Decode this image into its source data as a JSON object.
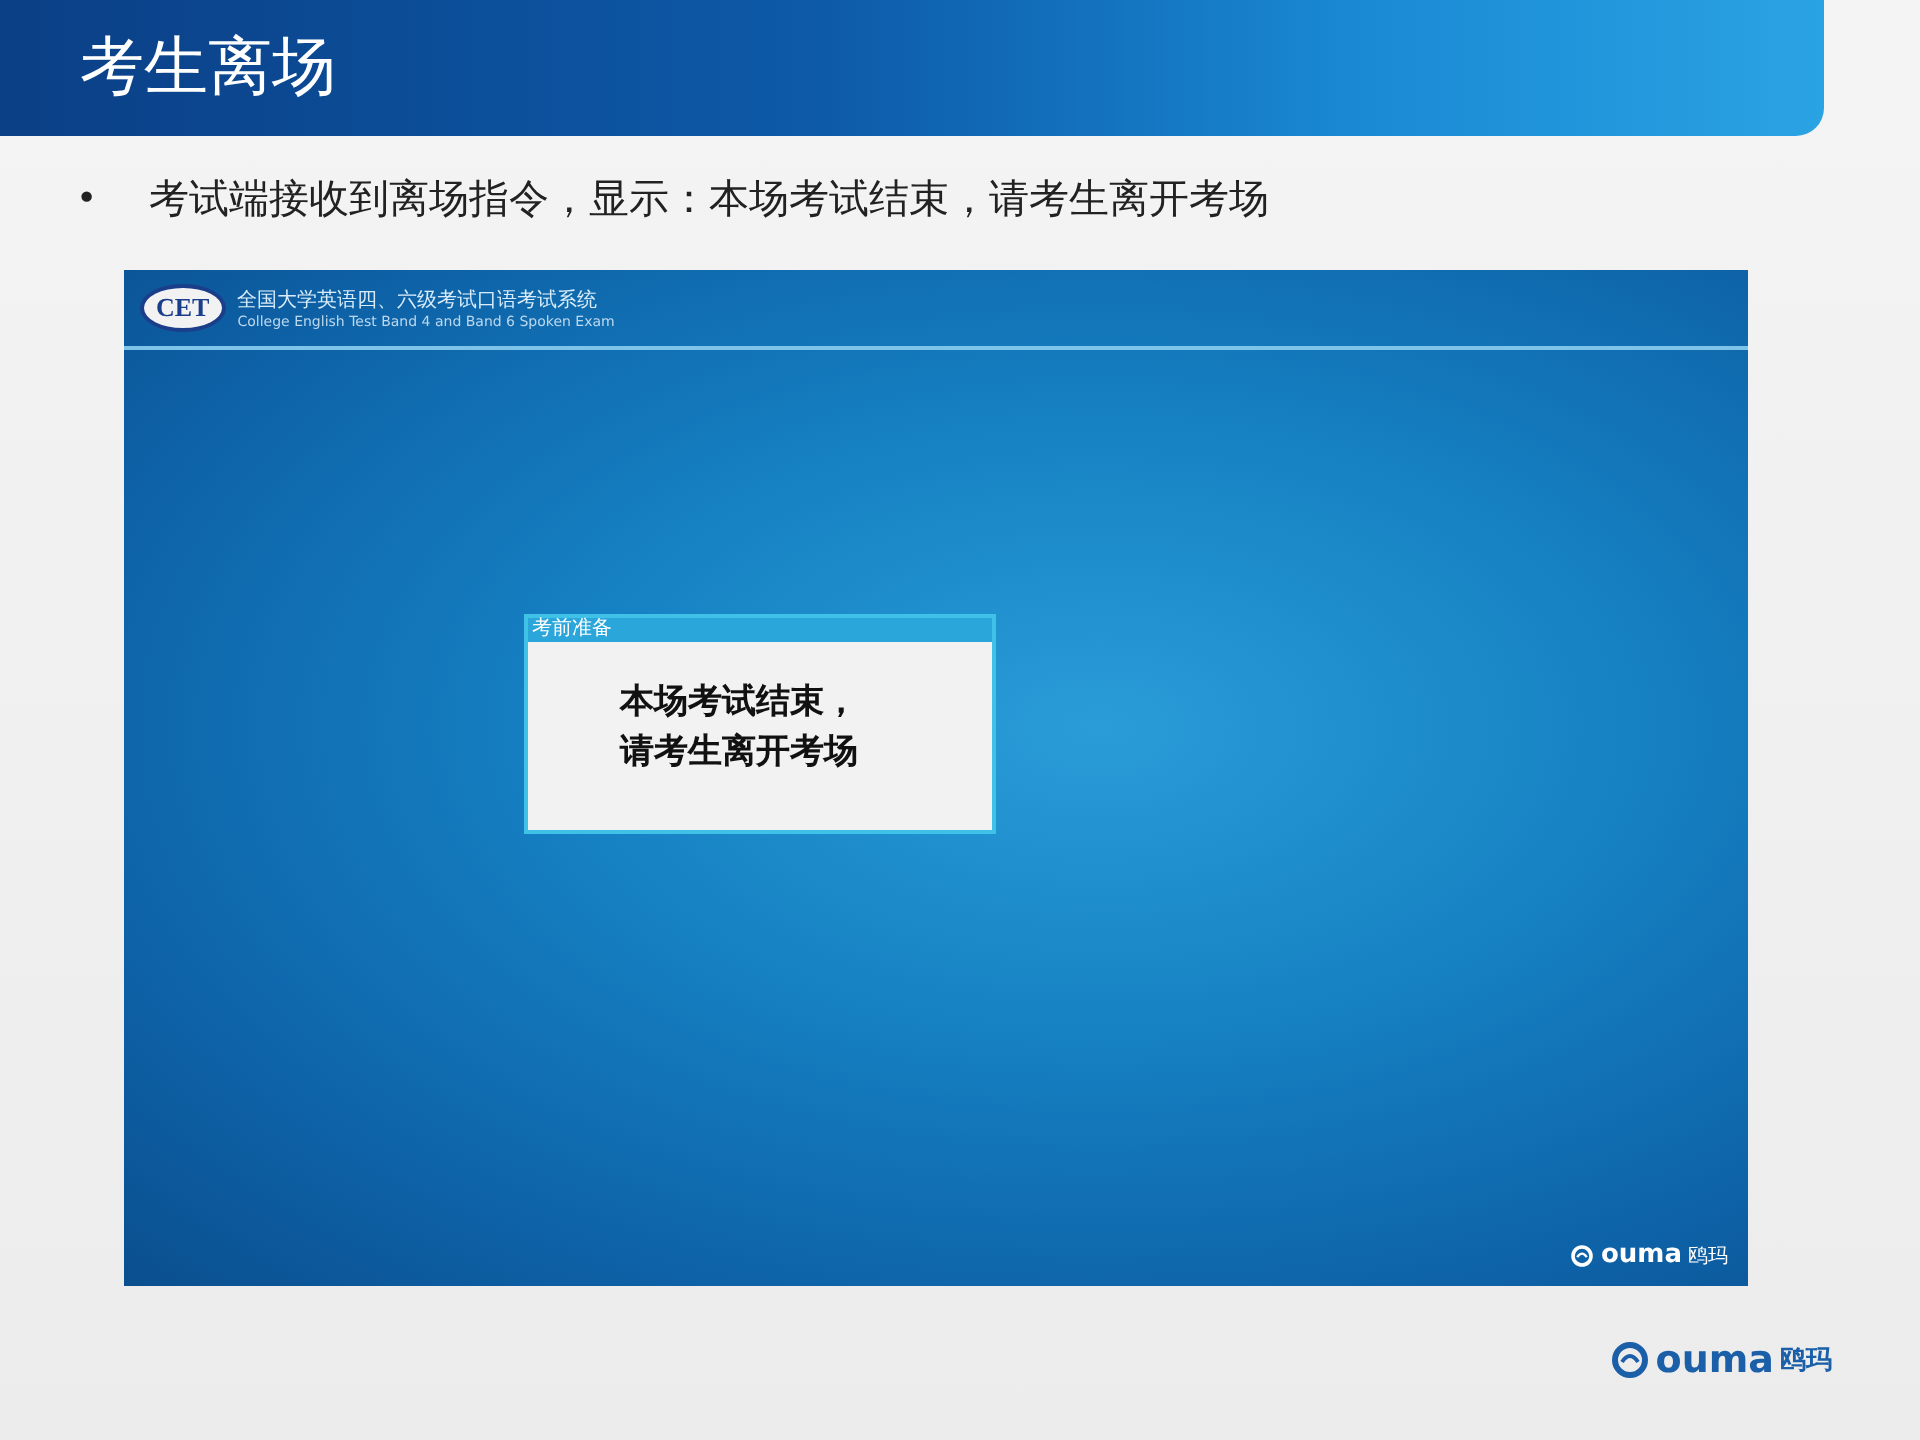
{
  "slide_title": "考生离场",
  "bullet": {
    "marker": "•",
    "text": "考试端接收到离场指令，显示：本场考试结束，请考生离开考场"
  },
  "screen": {
    "logo": "CET",
    "system_title": "全国大学英语四、六级考试口语考试系统",
    "system_subtitle": "College English Test Band 4 and Band 6 Spoken Exam",
    "dialog": {
      "title": "考前准备",
      "lines": [
        "本场考试结束，",
        "请考生离开考场"
      ]
    },
    "brand": {
      "name": "ouma",
      "cn": "鸥玛"
    }
  },
  "footer_brand": {
    "name": "ouma",
    "cn": "鸥玛"
  }
}
